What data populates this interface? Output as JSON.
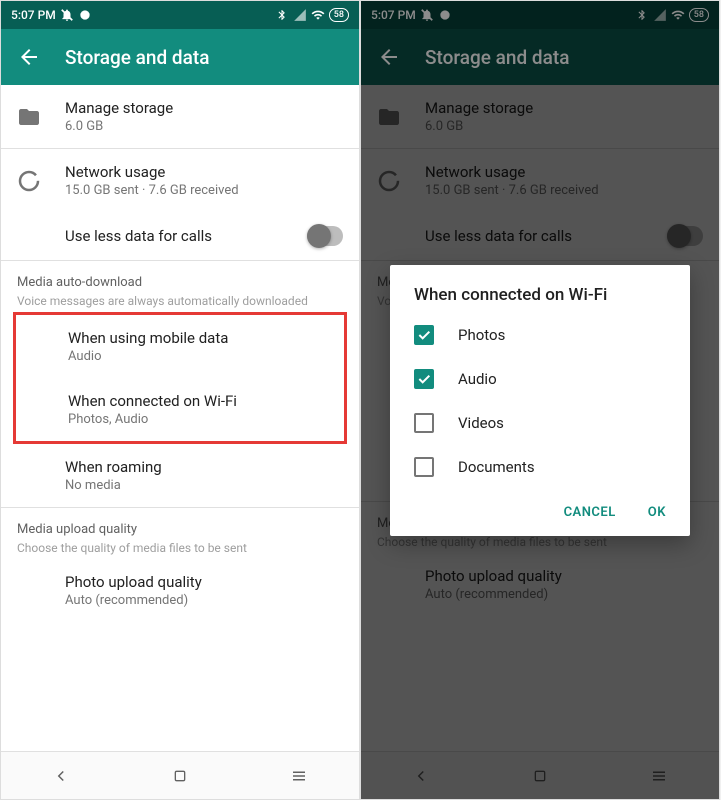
{
  "status": {
    "time": "5:07 PM",
    "battery": 58
  },
  "header": {
    "title": "Storage and data"
  },
  "items": {
    "manage_storage": {
      "title": "Manage storage",
      "subtitle": "6.0 GB"
    },
    "network_usage": {
      "title": "Network usage",
      "subtitle": "15.0 GB sent · 7.6 GB received"
    },
    "less_data": {
      "title": "Use less data for calls"
    }
  },
  "media_section": {
    "title": "Media auto-download",
    "desc": "Voice messages are always automatically downloaded",
    "mobile": {
      "title": "When using mobile data",
      "subtitle": "Audio"
    },
    "wifi": {
      "title": "When connected on Wi-Fi",
      "subtitle": "Photos, Audio"
    },
    "roaming": {
      "title": "When roaming",
      "subtitle": "No media"
    }
  },
  "upload_section": {
    "title": "Media upload quality",
    "desc": "Choose the quality of media files to be sent",
    "photo": {
      "title": "Photo upload quality",
      "subtitle": "Auto (recommended)"
    }
  },
  "dialog": {
    "title": "When connected on Wi-Fi",
    "options": {
      "photos": {
        "label": "Photos",
        "checked": true
      },
      "audio": {
        "label": "Audio",
        "checked": true
      },
      "videos": {
        "label": "Videos",
        "checked": false
      },
      "documents": {
        "label": "Documents",
        "checked": false
      }
    },
    "cancel": "CANCEL",
    "ok": "OK"
  }
}
